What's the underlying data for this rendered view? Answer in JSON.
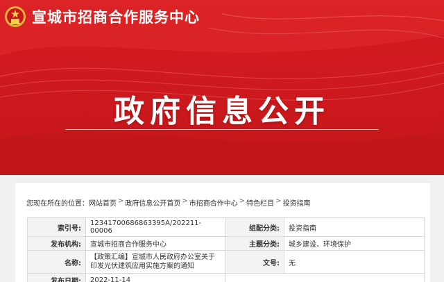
{
  "header": {
    "site_title": "宣城市招商合作服务中心"
  },
  "banner": {
    "main_title": "政府信息公开"
  },
  "breadcrumb": {
    "prefix": "您现在所在的位置：",
    "items": [
      "网站首页",
      "政府信息公开首页",
      "市招商合作中心",
      "特色栏目",
      "投资指南"
    ],
    "separator": ">"
  },
  "info": {
    "index_label": "索引号:",
    "index_value": "12341700686863395A/202211-00006",
    "category_label": "组配分类:",
    "category_value": "投资指南",
    "publisher_label": "发布机构:",
    "publisher_value": "宣城市招商合作服务中心",
    "topic_label": "主题分类:",
    "topic_value": "城乡建设、环境保护",
    "name_label": "名称:",
    "name_value": "【政策汇编】宣城市人民政府办公室关于印发光伏建筑应用实施方案的通知",
    "docno_label": "文号:",
    "docno_value": "无",
    "date_label": "发布日期:",
    "date_value": "2022-11-14"
  },
  "colors": {
    "banner_red": "#d7191c",
    "label_bg": "#f3f3f3"
  }
}
